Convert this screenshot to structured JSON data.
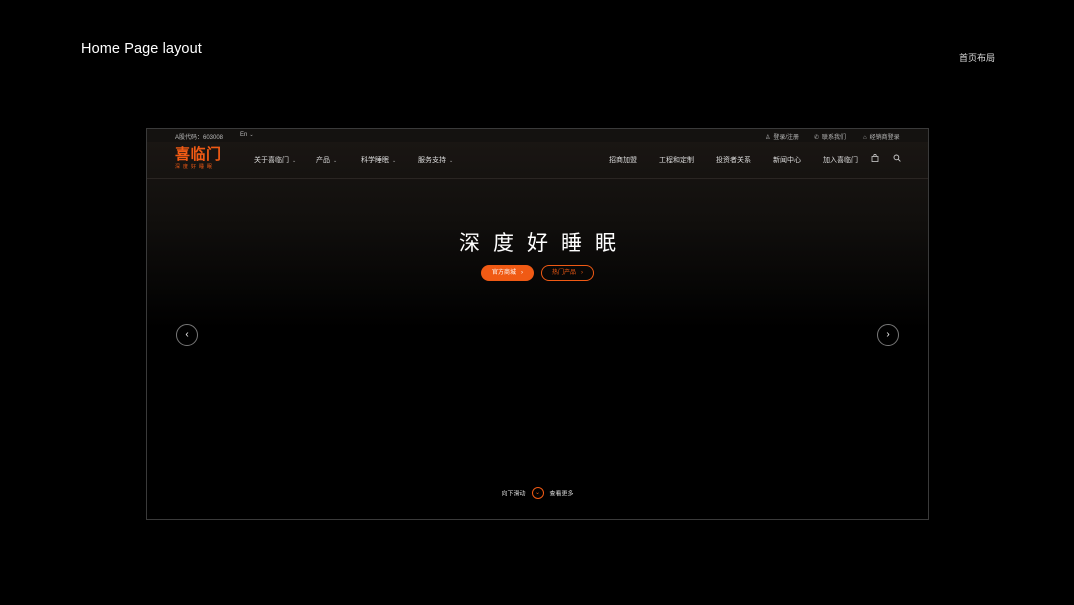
{
  "presentation": {
    "title": "Home  Page layout",
    "title_cn": "首页布局"
  },
  "topbar": {
    "stock": "A股代码：603008",
    "lang": "En",
    "links": [
      {
        "label": "登录/注册",
        "icon": "user-icon"
      },
      {
        "label": "联系我们",
        "icon": "phone-icon"
      },
      {
        "label": "经销商登录",
        "icon": "lock-icon"
      }
    ]
  },
  "logo": {
    "main": "喜临门",
    "sub": "深度好睡眠"
  },
  "nav": {
    "left": [
      {
        "label": "关于喜临门"
      },
      {
        "label": "产品"
      },
      {
        "label": "科学睡眠"
      },
      {
        "label": "服务支持"
      }
    ],
    "right": [
      {
        "label": "招商加盟"
      },
      {
        "label": "工程和定制"
      },
      {
        "label": "投资者关系"
      },
      {
        "label": "新闻中心"
      },
      {
        "label": "加入喜临门"
      }
    ],
    "icons": [
      "cart-icon",
      "search-icon"
    ]
  },
  "hero": {
    "title": "深度好睡眠",
    "primary_button": "官方商城",
    "secondary_button": "热门产品"
  },
  "scroll": {
    "left": "向下滑动",
    "right": "查看更多"
  },
  "colors": {
    "accent": "#f05a14",
    "background": "#000000"
  }
}
